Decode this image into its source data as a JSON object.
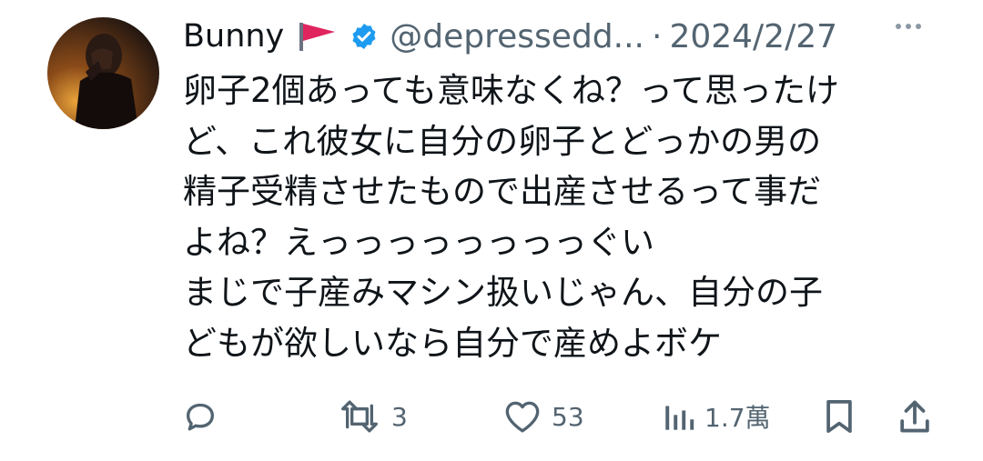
{
  "tweet": {
    "author_name": "Bunny",
    "handle": "@depressedd...",
    "separator": "·",
    "date": "2024/2/27",
    "lines": [
      "卵子2個あっても意味なくね？って思ったけ",
      "ど、これ彼女に自分の卵子とどっかの男の",
      "精子受精させたもので出産させるって事だ",
      "よね？えっっっっっっっっぐい",
      "まじで子産みマシン扱いじゃん、自分の子",
      "どもが欲しいなら自分で産めよボケ"
    ]
  },
  "actions": {
    "reply": {
      "icon": "reply-icon",
      "count": ""
    },
    "retweet": {
      "icon": "retweet-icon",
      "count": "3"
    },
    "like": {
      "icon": "heart-icon",
      "count": "53"
    },
    "views": {
      "icon": "views-icon",
      "count": "1.7萬"
    },
    "bookmark": {
      "icon": "bookmark-icon"
    },
    "share": {
      "icon": "share-icon"
    }
  },
  "colors": {
    "text": "#0f1419",
    "secondary": "#536471",
    "verified": "#1d9bf0",
    "flag": "#e0245e"
  }
}
